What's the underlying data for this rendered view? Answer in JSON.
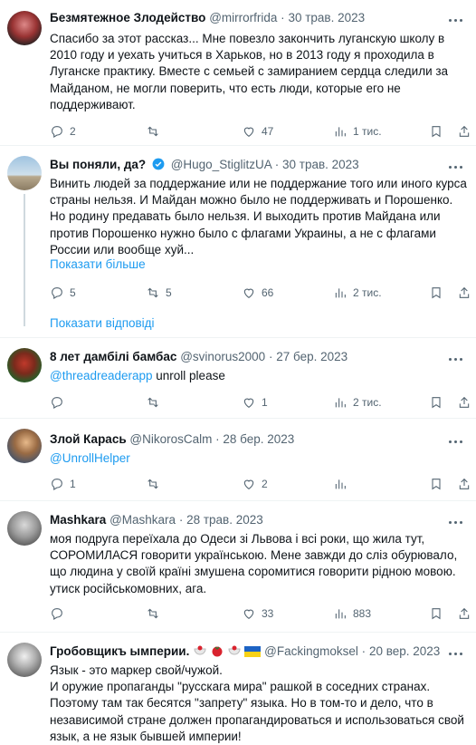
{
  "tweets": [
    {
      "name": "Безмятежное Злодейство",
      "handle": "@mirrorfrida",
      "date": "30 трав. 2023",
      "text": "Спасибо за этот рассказ... Мне повезло закончить луганскую школу в 2010 году и уехать учиться в Харьков, но в 2013 году я проходила в Луганске практику. Вместе с семьей с замиранием сердца следили за Майданом, не могли поверить, что есть люди, которые его не поддерживают.",
      "replies": "2",
      "retweets": "",
      "likes": "47",
      "views": "1 тис."
    },
    {
      "name": "Вы поняли, да?",
      "handle": "@Hugo_StiglitzUA",
      "date": "30 трав. 2023",
      "text": "Винить людей за поддержание или не поддержание того или иного курса страны нельзя. И Майдан можно было не поддерживать и Порошенко. Но родину предавать было нельзя. И выходить против Майдана или против Порошенко нужно было с флагами Украины, а не с флагами России или вообще хуй...",
      "show_more": "Показати більше",
      "replies": "5",
      "retweets": "5",
      "likes": "66",
      "views": "2 тис."
    },
    {
      "name": "8 лет дамбілі бамбас",
      "handle": "@svinorus2000",
      "date": "27 бер. 2023",
      "mention": "@threadreaderapp",
      "text": " unroll please",
      "replies": "",
      "retweets": "",
      "likes": "1",
      "views": "2 тис."
    },
    {
      "name": "Злой Карась",
      "handle": "@NikorosCalm",
      "date": "28 бер. 2023",
      "mention": "@UnrollHelper",
      "text": "",
      "replies": "1",
      "retweets": "",
      "likes": "2",
      "views": ""
    },
    {
      "name": "Mashkara",
      "handle": "@Mashkara",
      "date": "28 трав. 2023",
      "text": "моя подруга переїхала до Одеси зі Львова і всі роки, що жила тут, СОРОМИЛАСЯ говорити українською. Мене завжди до сліз обурювало, що людина у своїй країні змушена соромитися говорити рідною мовою. утиск російськомовних, ага.",
      "replies": "",
      "retweets": "",
      "likes": "33",
      "views": "883"
    },
    {
      "name": "Гробовщикъ ымперии.",
      "handle": "@Fackingmoksel",
      "date": "20 вер. 2023",
      "text_lines": [
        "Язык - это маркер свой/чужой.",
        "И оружие пропаганды \"русскага мира\" рашкой в соседних странах. Поэтому там так бесятся \"запрету\" языка. Но в том-то и дело, что в независимой стране должен пропагандироваться и использоваться свой язык, а не язык бывшей империи!"
      ]
    }
  ],
  "show_replies": "Показати відповіді",
  "colors": {
    "accent": "#1d9bf0",
    "muted": "#536471",
    "divider": "#eff3f4"
  }
}
